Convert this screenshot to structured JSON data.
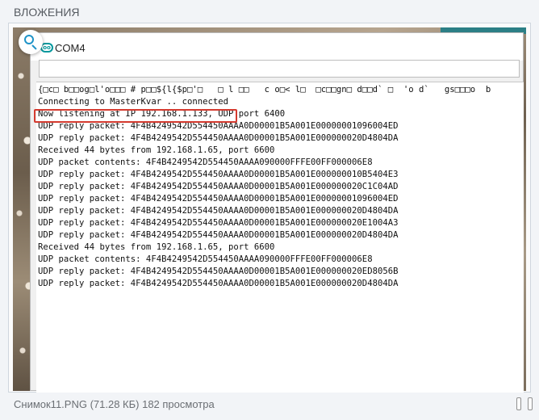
{
  "attachments": {
    "title": "ВЛОЖЕНИЯ"
  },
  "serial_monitor": {
    "window_title": "COM4",
    "app_icon_glyph": "oo",
    "input_value": "",
    "lines": [
      "{□c□ b□□og□l'o□□□ # p□□${l{$p□'□   □ l □□   c o□< l□  □c□□gn□ d□□d` □  'o d`   gs□□□o  b",
      "Connecting to MasterKvar .. connected",
      "Now listening at IP 192.168.1.133, UDP port 6400",
      "UDP reply packet: 4F4B4249542D554450AAAA0D00001B5A001E00000001096004ED",
      "UDP reply packet: 4F4B4249542D554450AAAA0D00001B5A001E000000020D4804DA",
      "Received 44 bytes from 192.168.1.65, port 6600",
      "UDP packet contents: 4F4B4249542D554450AAAA090000FFFE00FF000006E8",
      "UDP reply packet: 4F4B4249542D554450AAAA0D00001B5A001E000000010B5404E3",
      "UDP reply packet: 4F4B4249542D554450AAAA0D00001B5A001E000000020C1C04AD",
      "UDP reply packet: 4F4B4249542D554450AAAA0D00001B5A001E00000001096004ED",
      "UDP reply packet: 4F4B4249542D554450AAAA0D00001B5A001E000000020D4804DA",
      "UDP reply packet: 4F4B4249542D554450AAAA0D00001B5A001E000000020E1004A3",
      "UDP reply packet: 4F4B4249542D554450AAAA0D00001B5A001E000000020D4804DA",
      "Received 44 bytes from 192.168.1.65, port 6600",
      "UDP packet contents: 4F4B4249542D554450AAAA090000FFFE00FF000006E8",
      "UDP reply packet: 4F4B4249542D554450AAAA0D00001B5A001E000000020ED8056B",
      "UDP reply packet: 4F4B4249542D554450AAAA0D00001B5A001E000000020D4804DA"
    ]
  },
  "caption": "Снимок11.PNG (71.28 КБ) 182 просмотра",
  "icons": {
    "zoom": "magnifier-icon",
    "app": "arduino-icon"
  },
  "colors": {
    "highlight": "#d43a2f",
    "accent": "#1f93c8",
    "arduino": "#00979c"
  }
}
